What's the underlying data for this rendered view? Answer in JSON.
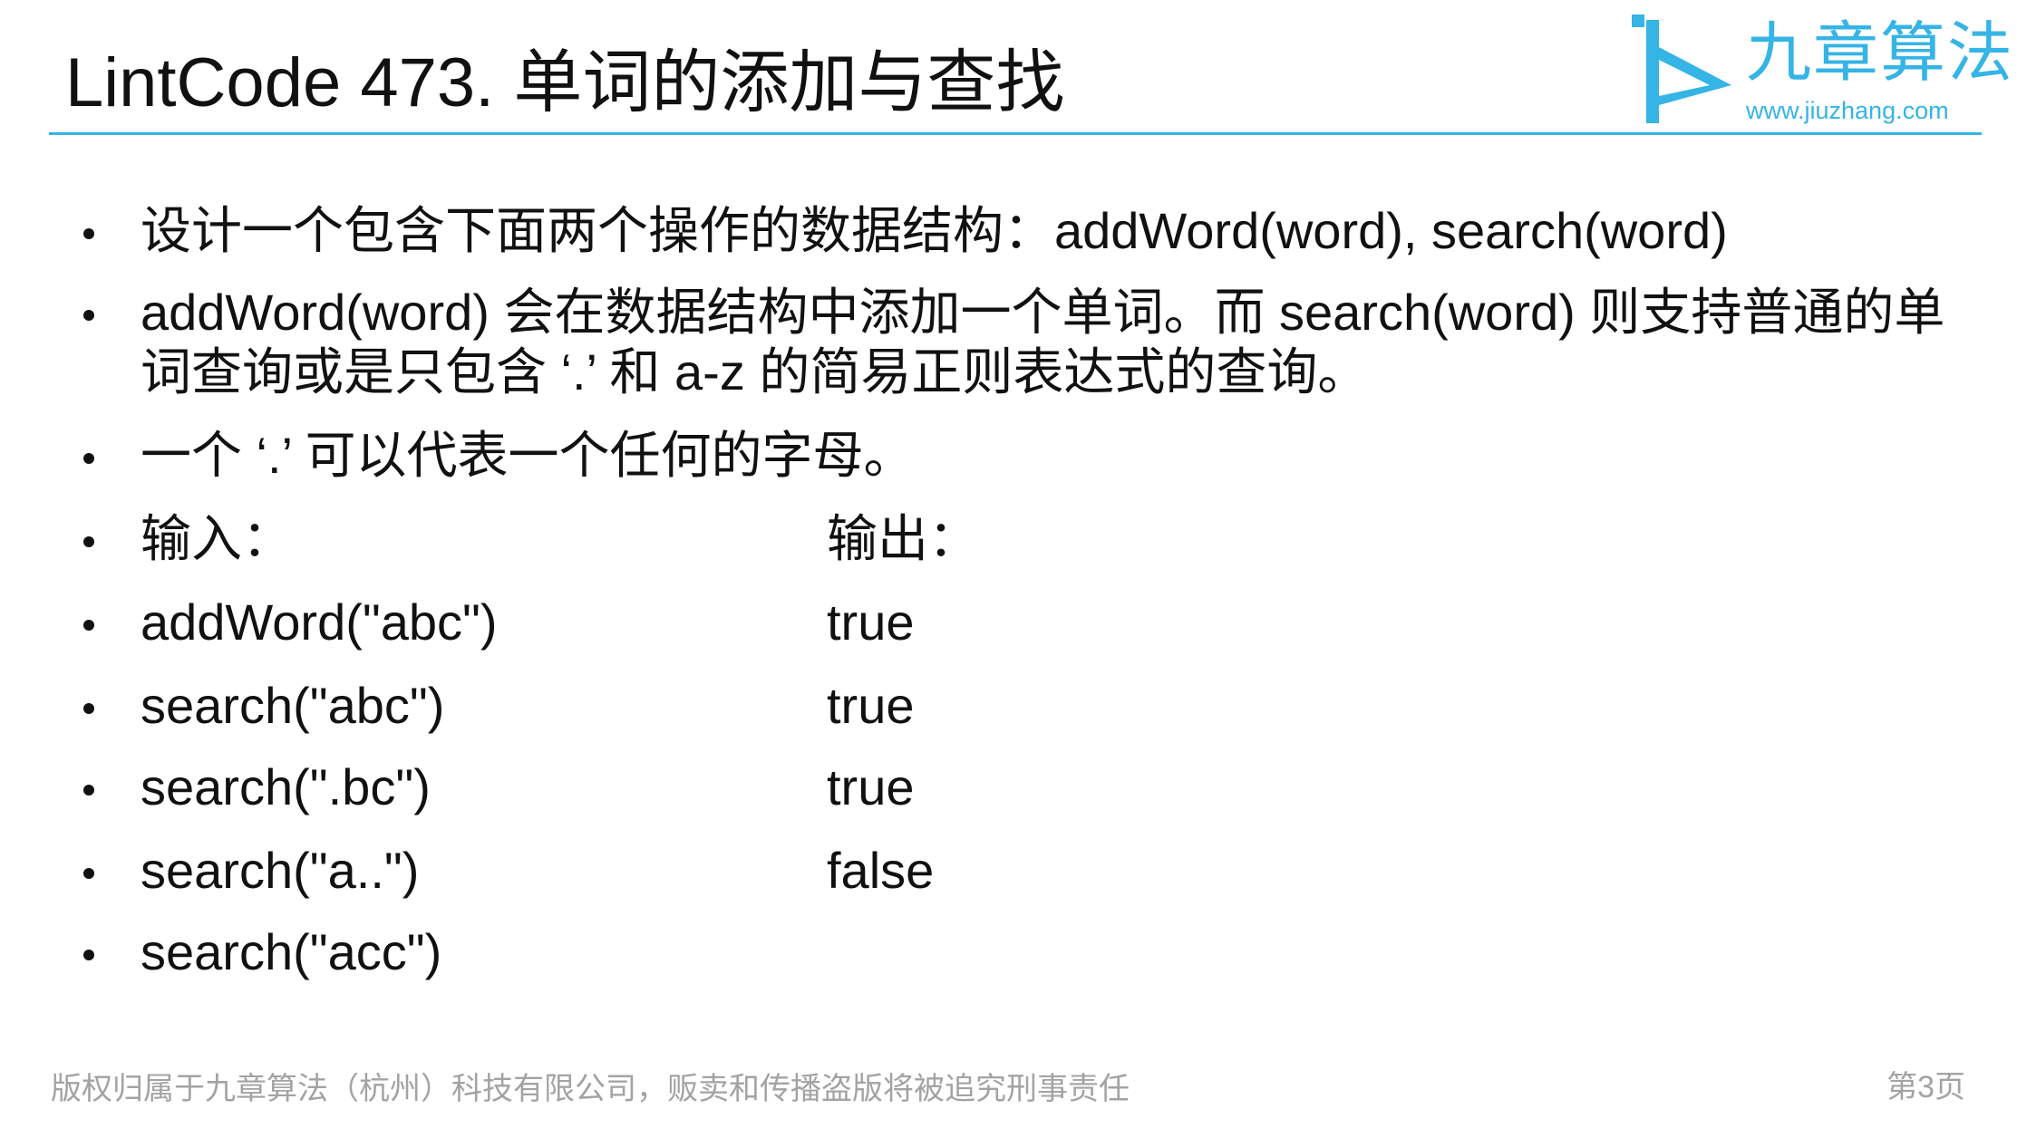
{
  "slide": {
    "title": "LintCode 473. 单词的添加与查找"
  },
  "logo": {
    "name": "九章算法",
    "url": "www.jiuzhang.com",
    "accent_color": "#35b4e6"
  },
  "bullets": [
    {
      "text": "设计一个包含下面两个操作的数据结构：addWord(word), search(word)"
    },
    {
      "line1": "addWord(word) 会在数据结构中添加一个单词。而 search(word) 则支持普通的单",
      "line2": "词查询或是只包含 ‘.’ 和 a-z 的简易正则表达式的查询。"
    },
    {
      "text": "一个 ‘.’ 可以代表一个任何的字母。"
    },
    {
      "input": "输入：",
      "output": "输出："
    },
    {
      "input": "addWord(\"abc\")",
      "output": "true"
    },
    {
      "input": "search(\"abc\")",
      "output": "true"
    },
    {
      "input": "search(\".bc\")",
      "output": "true"
    },
    {
      "input": "search(\"a..\")",
      "output": "false"
    },
    {
      "input": "search(\"acc\")",
      "output": ""
    }
  ],
  "footer": {
    "copyright": "版权归属于九章算法（杭州）科技有限公司，贩卖和传播盗版将被追究刑事责任",
    "page": "第3页"
  }
}
